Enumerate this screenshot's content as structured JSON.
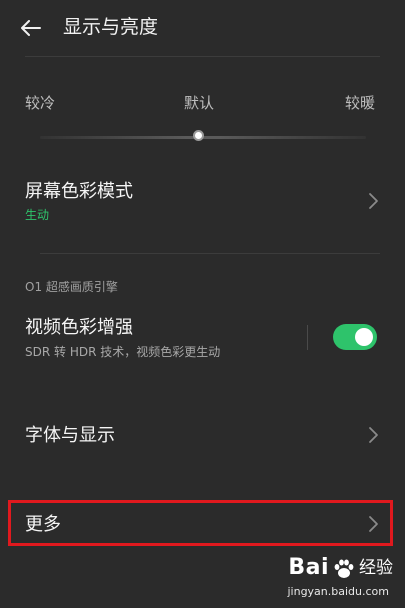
{
  "header": {
    "title": "显示与亮度"
  },
  "color_temperature": {
    "cold_label": "较冷",
    "default_label": "默认",
    "warm_label": "较暖",
    "slider_value_fraction": 0.5
  },
  "screen_color_mode": {
    "title": "屏幕色彩模式",
    "value": "生动",
    "value_color": "#2ec36b"
  },
  "section": {
    "label": "O1 超感画质引擎"
  },
  "video_color_enhance": {
    "title": "视频色彩增强",
    "subtitle": "SDR 转 HDR 技术，视频色彩更生动",
    "enabled": true
  },
  "font_display": {
    "title": "字体与显示"
  },
  "more": {
    "title": "更多"
  },
  "watermark": {
    "brand": "Bai",
    "brand_suffix": "经验",
    "url": "jingyan.baidu.com"
  },
  "colors": {
    "accent_green": "#2ec36b",
    "highlight_red": "#e0191e",
    "background": "#2b2b2b"
  }
}
